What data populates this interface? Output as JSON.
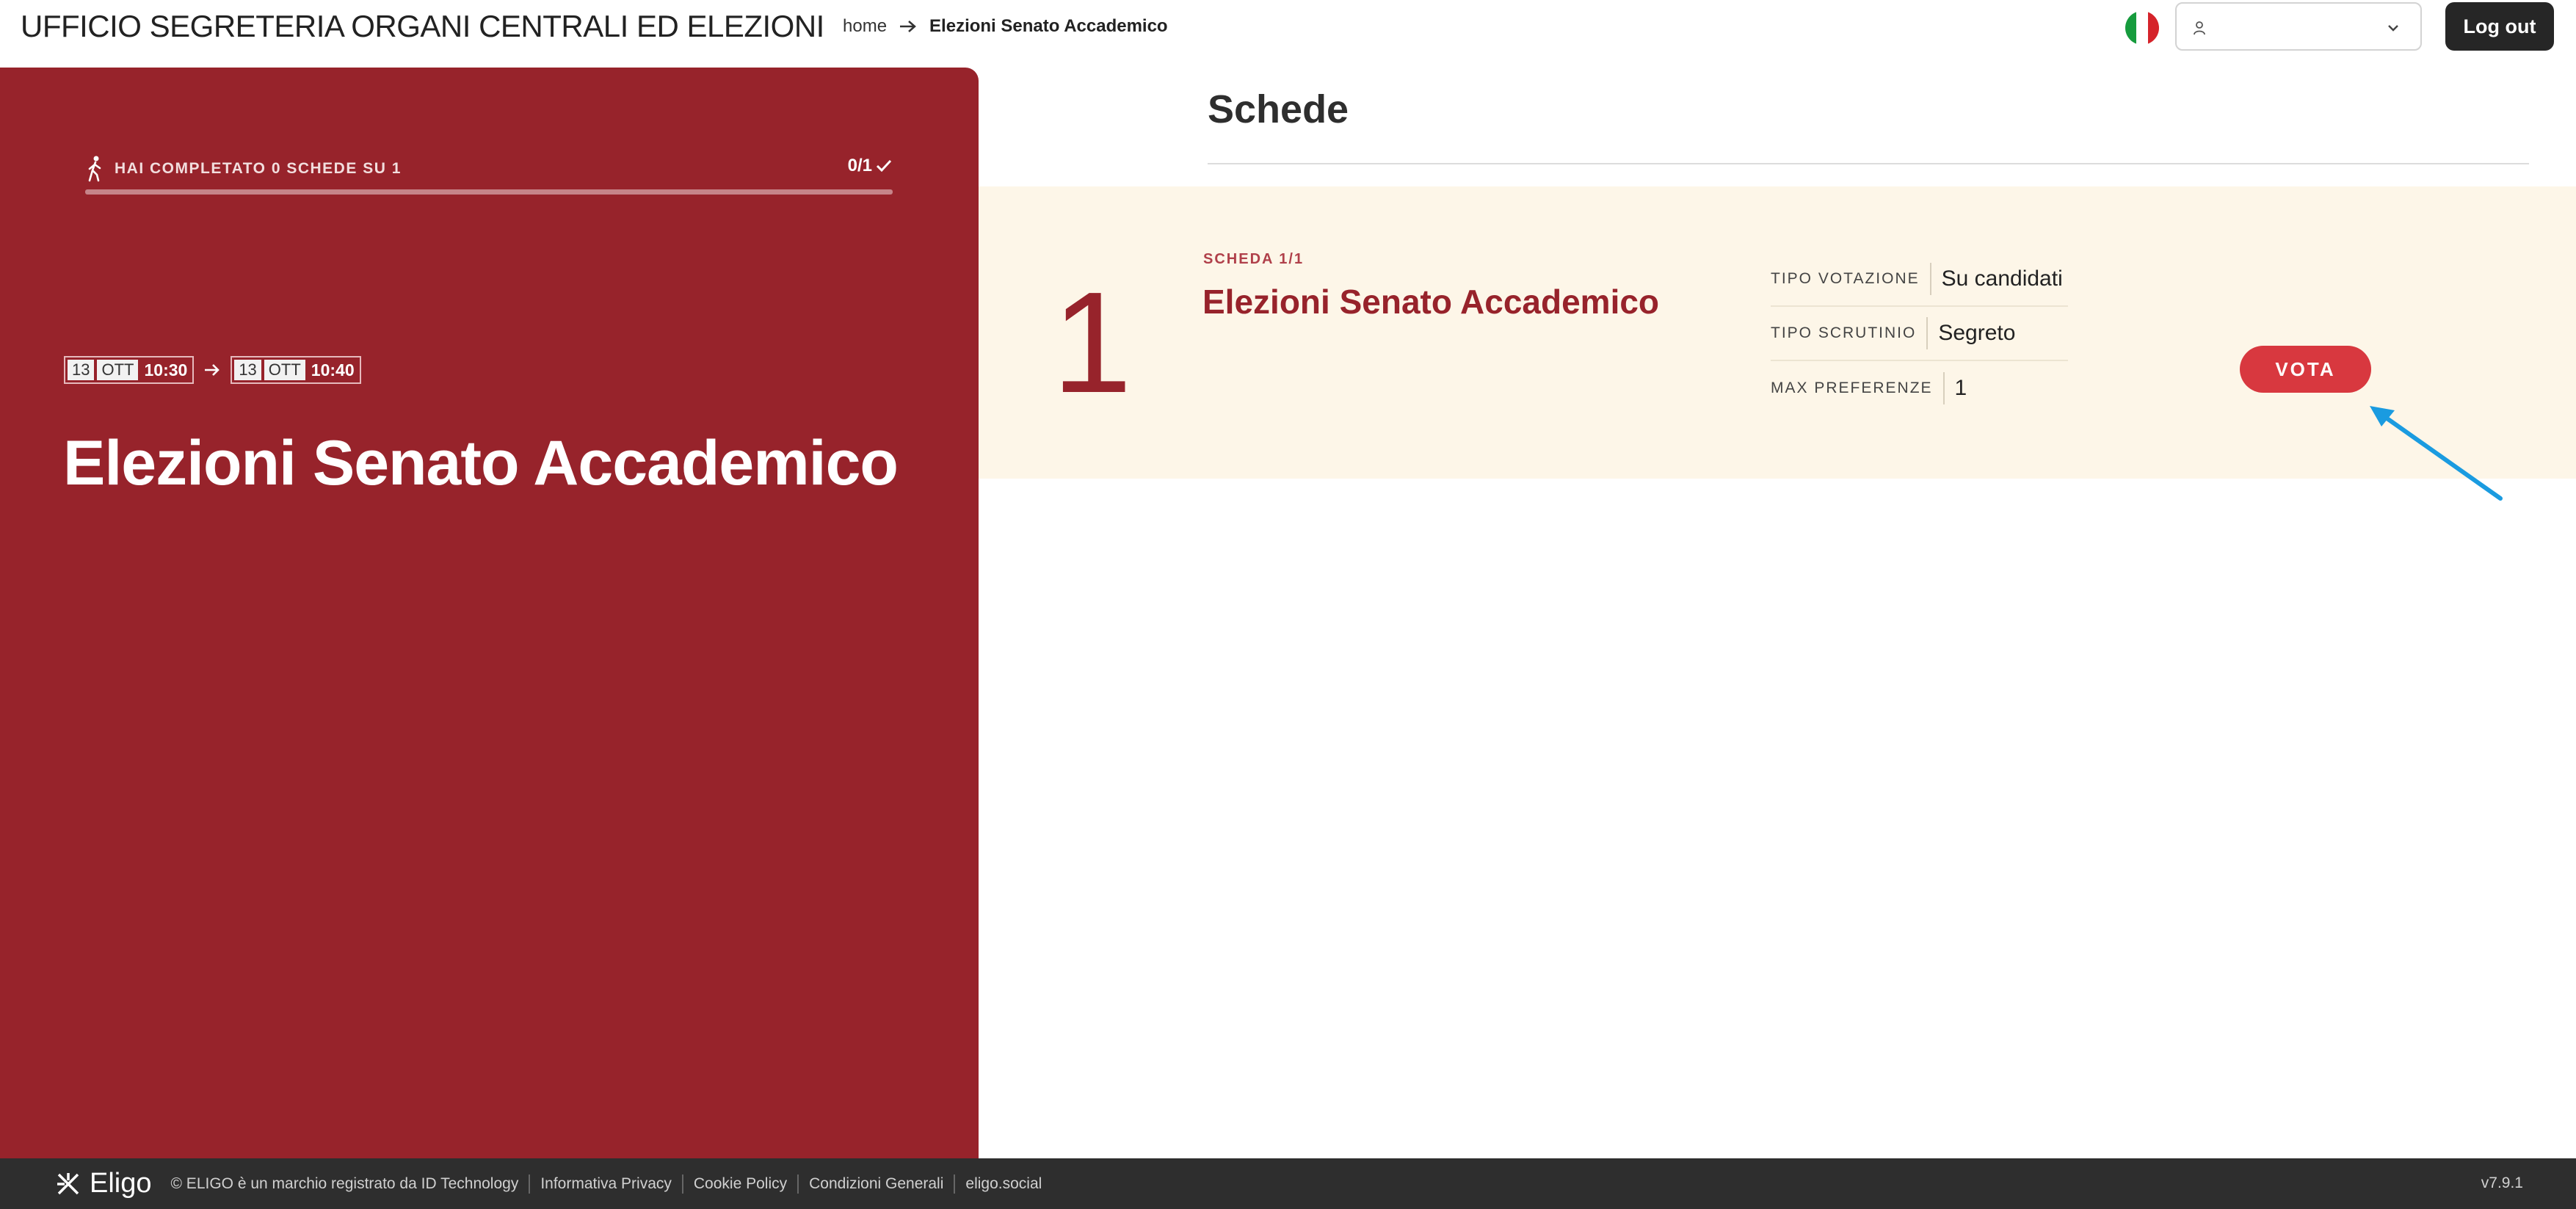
{
  "header": {
    "org_title": "UFFICIO SEGRETERIA ORGANI CENTRALI ED ELEZIONI",
    "breadcrumb": {
      "home": "home",
      "current": "Elezioni Senato Accademico"
    },
    "user_select_value": "",
    "logout_label": "Log out",
    "language_flag": "flag-italy-icon"
  },
  "left_panel": {
    "progress_text": "HAI COMPLETATO 0 SCHEDE SU 1",
    "progress_count": "0/1",
    "progress_fraction": 0,
    "start": {
      "day": "13",
      "month": "OTT",
      "time": "10:30"
    },
    "end": {
      "day": "13",
      "month": "OTT",
      "time": "10:40"
    },
    "title": "Elezioni Senato Accademico"
  },
  "main": {
    "section_title": "Schede",
    "card": {
      "number": "1",
      "kicker": "SCHEDA 1/1",
      "title": "Elezioni Senato Accademico",
      "details": [
        {
          "label": "TIPO VOTAZIONE",
          "value": "Su candidati"
        },
        {
          "label": "TIPO SCRUTINIO",
          "value": "Segreto"
        },
        {
          "label": "MAX PREFERENZE",
          "value": "1"
        }
      ],
      "vote_label": "VOTA"
    }
  },
  "footer": {
    "brand": "Eligo",
    "copyright": "© ELIGO è un marchio registrato da ID Technology",
    "links": [
      "Informativa Privacy",
      "Cookie Policy",
      "Condizioni Generali",
      "eligo.social"
    ],
    "version": "v7.9.1"
  },
  "colors": {
    "brand_red": "#97232b",
    "vote_button": "#d8383f",
    "card_bg": "#fdf6e8",
    "footer_bg": "#2e2e2e",
    "annotation_arrow": "#1a9be0"
  }
}
